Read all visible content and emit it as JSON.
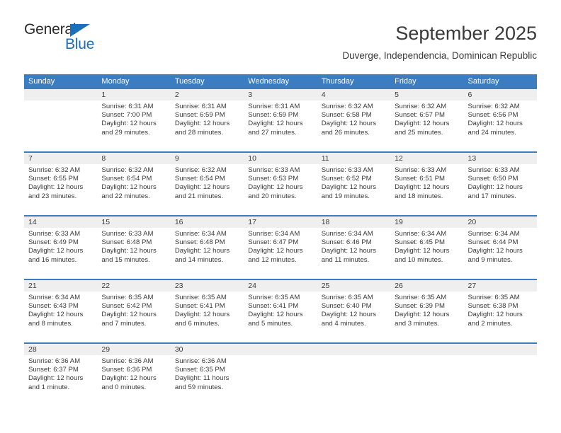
{
  "brand": {
    "name_part1": "General",
    "name_part2": "Blue",
    "triangle_color": "#1c6fba",
    "text_color": "#2b2b2b",
    "accent_color": "#1c6fba"
  },
  "header": {
    "title": "September 2025",
    "subtitle": "Duverge, Independencia, Dominican Republic"
  },
  "theme": {
    "header_bar": "#3b7dc0",
    "header_text": "#ffffff",
    "daynum_band": "#efefef",
    "row_separator": "#3b7dc0",
    "body_text": "#3a3a3a"
  },
  "weekdays": [
    "Sunday",
    "Monday",
    "Tuesday",
    "Wednesday",
    "Thursday",
    "Friday",
    "Saturday"
  ],
  "weeks": [
    [
      {
        "day": "",
        "sunrise": "",
        "sunset": "",
        "daylight": ""
      },
      {
        "day": "1",
        "sunrise": "Sunrise: 6:31 AM",
        "sunset": "Sunset: 7:00 PM",
        "daylight": "Daylight: 12 hours and 29 minutes."
      },
      {
        "day": "2",
        "sunrise": "Sunrise: 6:31 AM",
        "sunset": "Sunset: 6:59 PM",
        "daylight": "Daylight: 12 hours and 28 minutes."
      },
      {
        "day": "3",
        "sunrise": "Sunrise: 6:31 AM",
        "sunset": "Sunset: 6:59 PM",
        "daylight": "Daylight: 12 hours and 27 minutes."
      },
      {
        "day": "4",
        "sunrise": "Sunrise: 6:32 AM",
        "sunset": "Sunset: 6:58 PM",
        "daylight": "Daylight: 12 hours and 26 minutes."
      },
      {
        "day": "5",
        "sunrise": "Sunrise: 6:32 AM",
        "sunset": "Sunset: 6:57 PM",
        "daylight": "Daylight: 12 hours and 25 minutes."
      },
      {
        "day": "6",
        "sunrise": "Sunrise: 6:32 AM",
        "sunset": "Sunset: 6:56 PM",
        "daylight": "Daylight: 12 hours and 24 minutes."
      }
    ],
    [
      {
        "day": "7",
        "sunrise": "Sunrise: 6:32 AM",
        "sunset": "Sunset: 6:55 PM",
        "daylight": "Daylight: 12 hours and 23 minutes."
      },
      {
        "day": "8",
        "sunrise": "Sunrise: 6:32 AM",
        "sunset": "Sunset: 6:54 PM",
        "daylight": "Daylight: 12 hours and 22 minutes."
      },
      {
        "day": "9",
        "sunrise": "Sunrise: 6:32 AM",
        "sunset": "Sunset: 6:54 PM",
        "daylight": "Daylight: 12 hours and 21 minutes."
      },
      {
        "day": "10",
        "sunrise": "Sunrise: 6:33 AM",
        "sunset": "Sunset: 6:53 PM",
        "daylight": "Daylight: 12 hours and 20 minutes."
      },
      {
        "day": "11",
        "sunrise": "Sunrise: 6:33 AM",
        "sunset": "Sunset: 6:52 PM",
        "daylight": "Daylight: 12 hours and 19 minutes."
      },
      {
        "day": "12",
        "sunrise": "Sunrise: 6:33 AM",
        "sunset": "Sunset: 6:51 PM",
        "daylight": "Daylight: 12 hours and 18 minutes."
      },
      {
        "day": "13",
        "sunrise": "Sunrise: 6:33 AM",
        "sunset": "Sunset: 6:50 PM",
        "daylight": "Daylight: 12 hours and 17 minutes."
      }
    ],
    [
      {
        "day": "14",
        "sunrise": "Sunrise: 6:33 AM",
        "sunset": "Sunset: 6:49 PM",
        "daylight": "Daylight: 12 hours and 16 minutes."
      },
      {
        "day": "15",
        "sunrise": "Sunrise: 6:33 AM",
        "sunset": "Sunset: 6:48 PM",
        "daylight": "Daylight: 12 hours and 15 minutes."
      },
      {
        "day": "16",
        "sunrise": "Sunrise: 6:34 AM",
        "sunset": "Sunset: 6:48 PM",
        "daylight": "Daylight: 12 hours and 14 minutes."
      },
      {
        "day": "17",
        "sunrise": "Sunrise: 6:34 AM",
        "sunset": "Sunset: 6:47 PM",
        "daylight": "Daylight: 12 hours and 12 minutes."
      },
      {
        "day": "18",
        "sunrise": "Sunrise: 6:34 AM",
        "sunset": "Sunset: 6:46 PM",
        "daylight": "Daylight: 12 hours and 11 minutes."
      },
      {
        "day": "19",
        "sunrise": "Sunrise: 6:34 AM",
        "sunset": "Sunset: 6:45 PM",
        "daylight": "Daylight: 12 hours and 10 minutes."
      },
      {
        "day": "20",
        "sunrise": "Sunrise: 6:34 AM",
        "sunset": "Sunset: 6:44 PM",
        "daylight": "Daylight: 12 hours and 9 minutes."
      }
    ],
    [
      {
        "day": "21",
        "sunrise": "Sunrise: 6:34 AM",
        "sunset": "Sunset: 6:43 PM",
        "daylight": "Daylight: 12 hours and 8 minutes."
      },
      {
        "day": "22",
        "sunrise": "Sunrise: 6:35 AM",
        "sunset": "Sunset: 6:42 PM",
        "daylight": "Daylight: 12 hours and 7 minutes."
      },
      {
        "day": "23",
        "sunrise": "Sunrise: 6:35 AM",
        "sunset": "Sunset: 6:41 PM",
        "daylight": "Daylight: 12 hours and 6 minutes."
      },
      {
        "day": "24",
        "sunrise": "Sunrise: 6:35 AM",
        "sunset": "Sunset: 6:41 PM",
        "daylight": "Daylight: 12 hours and 5 minutes."
      },
      {
        "day": "25",
        "sunrise": "Sunrise: 6:35 AM",
        "sunset": "Sunset: 6:40 PM",
        "daylight": "Daylight: 12 hours and 4 minutes."
      },
      {
        "day": "26",
        "sunrise": "Sunrise: 6:35 AM",
        "sunset": "Sunset: 6:39 PM",
        "daylight": "Daylight: 12 hours and 3 minutes."
      },
      {
        "day": "27",
        "sunrise": "Sunrise: 6:35 AM",
        "sunset": "Sunset: 6:38 PM",
        "daylight": "Daylight: 12 hours and 2 minutes."
      }
    ],
    [
      {
        "day": "28",
        "sunrise": "Sunrise: 6:36 AM",
        "sunset": "Sunset: 6:37 PM",
        "daylight": "Daylight: 12 hours and 1 minute."
      },
      {
        "day": "29",
        "sunrise": "Sunrise: 6:36 AM",
        "sunset": "Sunset: 6:36 PM",
        "daylight": "Daylight: 12 hours and 0 minutes."
      },
      {
        "day": "30",
        "sunrise": "Sunrise: 6:36 AM",
        "sunset": "Sunset: 6:35 PM",
        "daylight": "Daylight: 11 hours and 59 minutes."
      },
      {
        "day": "",
        "sunrise": "",
        "sunset": "",
        "daylight": ""
      },
      {
        "day": "",
        "sunrise": "",
        "sunset": "",
        "daylight": ""
      },
      {
        "day": "",
        "sunrise": "",
        "sunset": "",
        "daylight": ""
      },
      {
        "day": "",
        "sunrise": "",
        "sunset": "",
        "daylight": ""
      }
    ]
  ]
}
